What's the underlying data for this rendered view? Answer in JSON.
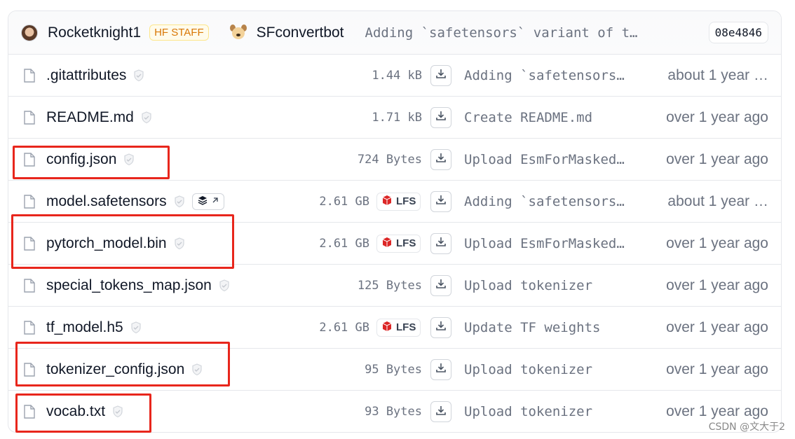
{
  "header": {
    "author": "Rocketknight1",
    "author_badge": "HF STAFF",
    "committer": "SFconvertbot",
    "commit_message": "Adding `safetensors` variant of t…",
    "commit_sha": "08e4846"
  },
  "files": [
    {
      "name": ".gitattributes",
      "size": "1.44 kB",
      "lfs": false,
      "commit": "Adding `safetensors…",
      "date": "about 1 year …",
      "safetensors_badge": false
    },
    {
      "name": "README.md",
      "size": "1.71 kB",
      "lfs": false,
      "commit": "Create README.md",
      "date": "over 1 year ago",
      "safetensors_badge": false
    },
    {
      "name": "config.json",
      "size": "724 Bytes",
      "lfs": false,
      "commit": "Upload EsmForMasked…",
      "date": "over 1 year ago",
      "safetensors_badge": false
    },
    {
      "name": "model.safetensors",
      "size": "2.61 GB",
      "lfs": true,
      "commit": "Adding `safetensors…",
      "date": "about 1 year …",
      "safetensors_badge": true
    },
    {
      "name": "pytorch_model.bin",
      "size": "2.61 GB",
      "lfs": true,
      "commit": "Upload EsmForMasked…",
      "date": "over 1 year ago",
      "safetensors_badge": false
    },
    {
      "name": "special_tokens_map.json",
      "size": "125 Bytes",
      "lfs": false,
      "commit": "Upload tokenizer",
      "date": "over 1 year ago",
      "safetensors_badge": false
    },
    {
      "name": "tf_model.h5",
      "size": "2.61 GB",
      "lfs": true,
      "commit": "Update TF weights",
      "date": "over 1 year ago",
      "safetensors_badge": false
    },
    {
      "name": "tokenizer_config.json",
      "size": "95 Bytes",
      "lfs": false,
      "commit": "Upload tokenizer",
      "date": "over 1 year ago",
      "safetensors_badge": false
    },
    {
      "name": "vocab.txt",
      "size": "93 Bytes",
      "lfs": false,
      "commit": "Upload tokenizer",
      "date": "over 1 year ago",
      "safetensors_badge": false
    }
  ],
  "lfs_label": "LFS",
  "highlighted_files": [
    "config.json",
    "pytorch_model.bin",
    "tokenizer_config.json",
    "vocab.txt"
  ],
  "colors": {
    "highlight": "#e8261c",
    "staff_badge": "#d97706",
    "lfs_icon": "#dc2626"
  },
  "watermark": "CSDN @文大于2"
}
